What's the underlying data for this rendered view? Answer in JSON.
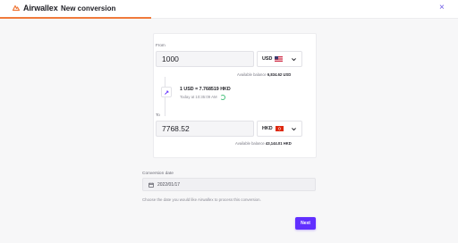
{
  "header": {
    "brand": "Airwallex",
    "title": "New conversion",
    "close_label": "×",
    "progress_fraction": 0.33
  },
  "from": {
    "label": "From",
    "amount": "1000",
    "currency": "USD",
    "flag": "us-flag",
    "available_label": "Available balance",
    "available_value": "6,834.62 USD"
  },
  "rate": {
    "text": "1 USD = 7.768519 HKD",
    "time": "Today at 10:35:09 AM"
  },
  "to": {
    "label": "To",
    "amount": "7768.52",
    "currency": "HKD",
    "flag": "hk-flag",
    "available_label": "Available balance",
    "available_value": "43,144.01 HKD"
  },
  "conversion_date": {
    "label": "Conversion date",
    "value": "2022/01/17",
    "help": "Choose the date you would like Airwallex to process this conversion."
  },
  "actions": {
    "next_label": "Next"
  },
  "colors": {
    "accent": "#612fff",
    "brand_orange": "#f07a3c"
  }
}
